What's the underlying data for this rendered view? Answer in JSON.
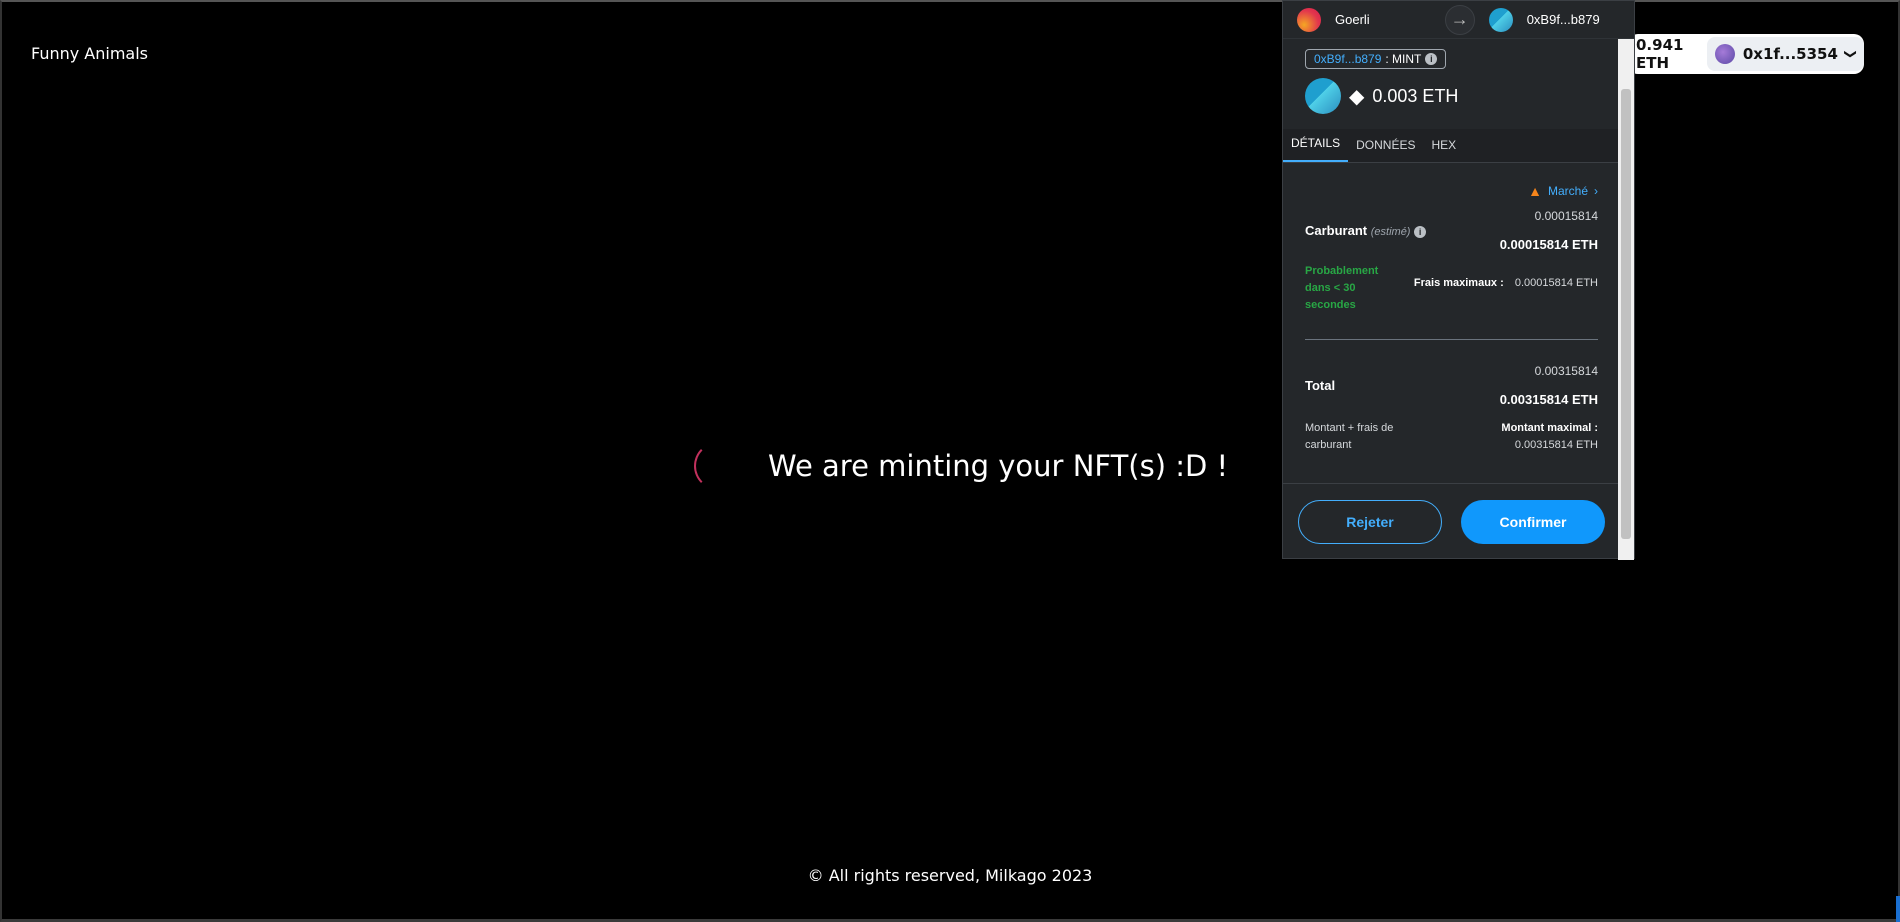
{
  "app": {
    "brand": "Funny Animals"
  },
  "wallet": {
    "balance": "0.941 ETH",
    "account": "0x1f...5354",
    "chevron": "❯"
  },
  "loading": {
    "message": "We are minting your NFT(s) :D !"
  },
  "footer": {
    "text": "© All rights reserved, Milkago 2023"
  },
  "popup": {
    "network": "Goerli",
    "to_address": "0xB9f...b879",
    "origin": {
      "address": "0xB9f...b879",
      "method": ": MINT"
    },
    "amount": "0.003 ETH",
    "tabs": [
      "DÉTAILS",
      "DONNÉES",
      "HEX"
    ],
    "market": "Marché",
    "gas": {
      "label": "Carburant",
      "hint": "(estimé)",
      "secondary": "0.00015814",
      "primary": "0.00015814 ETH",
      "likely": "Probablement dans < 30 secondes",
      "max_fee_label": "Frais maximaux :",
      "max_fee_value": "0.00015814 ETH"
    },
    "total": {
      "label": "Total",
      "secondary": "0.00315814",
      "primary": "0.00315814 ETH",
      "sub": "Montant + frais de carburant",
      "max_label": "Montant maximal :",
      "max_value": "0.00315814 ETH"
    },
    "buttons": {
      "reject": "Rejeter",
      "confirm": "Confirmer"
    }
  }
}
